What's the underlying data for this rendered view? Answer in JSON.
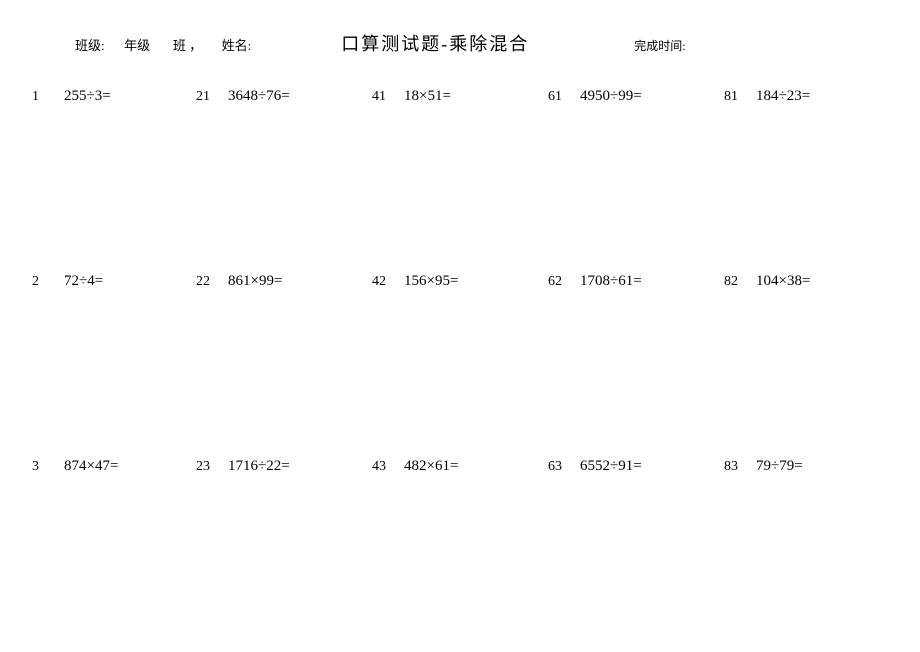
{
  "header": {
    "class_label": "班级:",
    "grade_label": "年级",
    "class_suffix": "班 ，",
    "name_label": "姓名:",
    "time_label": "完成时间:"
  },
  "title": "口算测试题-乘除混合",
  "problems": [
    {
      "num": "1",
      "expr": "255÷3="
    },
    {
      "num": "21",
      "expr": "3648÷76="
    },
    {
      "num": "41",
      "expr": "18×51="
    },
    {
      "num": "61",
      "expr": "4950÷99="
    },
    {
      "num": "81",
      "expr": "184÷23="
    },
    {
      "num": "2",
      "expr": "72÷4="
    },
    {
      "num": "22",
      "expr": "861×99="
    },
    {
      "num": "42",
      "expr": "156×95="
    },
    {
      "num": "62",
      "expr": "1708÷61="
    },
    {
      "num": "82",
      "expr": "104×38="
    },
    {
      "num": "3",
      "expr": "874×47="
    },
    {
      "num": "23",
      "expr": "1716÷22="
    },
    {
      "num": "43",
      "expr": "482×61="
    },
    {
      "num": "63",
      "expr": "6552÷91="
    },
    {
      "num": "83",
      "expr": "79÷79="
    }
  ]
}
